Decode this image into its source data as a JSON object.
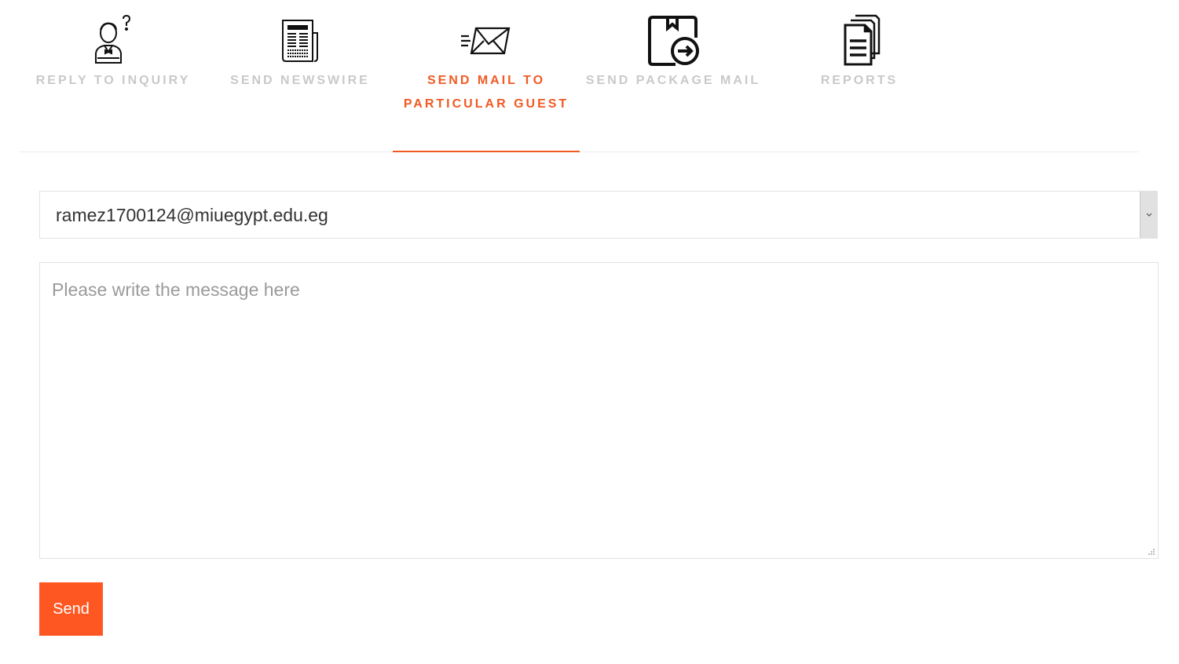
{
  "tabs": [
    {
      "label": "Reply to Inquiry",
      "icon": "person-question-icon",
      "active": false
    },
    {
      "label": "Send Newswire",
      "icon": "newspaper-icon",
      "active": false
    },
    {
      "label": "Send mail to particular guest",
      "icon": "send-mail-icon",
      "active": true
    },
    {
      "label": "Send Package Mail",
      "icon": "package-arrow-icon",
      "active": false
    },
    {
      "label": "Reports",
      "icon": "documents-icon",
      "active": false
    }
  ],
  "recipient": {
    "selected": "ramez1700124@miuegypt.edu.eg"
  },
  "message": {
    "placeholder": "Please write the message here"
  },
  "send_button": {
    "label": "Send"
  },
  "colors": {
    "accent": "#f15a24",
    "button": "#ff5722",
    "inactive_tab": "#c9c9c9"
  }
}
